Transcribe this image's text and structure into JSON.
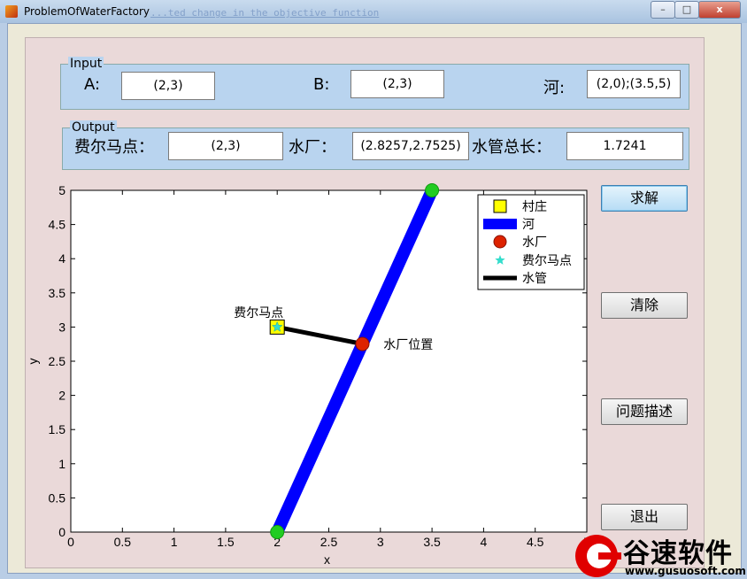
{
  "window": {
    "title": "ProblemOfWaterFactory",
    "ghost_text": "...ted change in the objective function",
    "min_label": "–",
    "max_label": "□",
    "close_label": "x"
  },
  "input": {
    "title": "Input",
    "a_label": "A:",
    "a_value": "(2,3)",
    "b_label": "B:",
    "b_value": "(2,3)",
    "river_label": "河:",
    "river_value": "(2,0);(3.5,5)"
  },
  "output": {
    "title": "Output",
    "fermat_label": "费尔马点：",
    "fermat_value": "(2,3)",
    "plant_label": "水厂：",
    "plant_value": "(2.8257,2.7525)",
    "pipe_label": "水管总长：",
    "pipe_value": "1.7241"
  },
  "buttons": {
    "solve": "求解",
    "clear": "清除",
    "describe": "问题描述",
    "exit": "退出"
  },
  "chart_data": {
    "type": "scatter",
    "xlabel": "x",
    "ylabel": "y",
    "xlim": [
      0,
      5
    ],
    "ylim": [
      0,
      5
    ],
    "xticks": [
      "0",
      "0.5",
      "1",
      "1.5",
      "2",
      "2.5",
      "3",
      "3.5",
      "4",
      "4.5",
      "5"
    ],
    "yticks": [
      "0",
      "0.5",
      "1",
      "1.5",
      "2",
      "2.5",
      "3",
      "3.5",
      "4",
      "4.5",
      "5"
    ],
    "river": {
      "name": "河",
      "x": [
        2,
        3.5
      ],
      "y": [
        0,
        5
      ],
      "color": "#0000ff"
    },
    "river_endpoints": {
      "x": [
        2,
        3.5
      ],
      "y": [
        0,
        5
      ],
      "color": "#22cc22"
    },
    "village": {
      "name": "村庄",
      "x": 2,
      "y": 3,
      "color": "#ffff00"
    },
    "plant": {
      "name": "水厂",
      "x": 2.8257,
      "y": 2.7525,
      "color": "#dd2200"
    },
    "fermat": {
      "name": "费尔马点",
      "x": 2,
      "y": 3,
      "color": "#33ddcc"
    },
    "pipe": {
      "name": "水管",
      "x": [
        2,
        2.8257
      ],
      "y": [
        3,
        2.7525
      ],
      "color": "#000000"
    },
    "annotations": [
      {
        "text": "费尔马点",
        "x": 1.58,
        "y": 3.15
      },
      {
        "text": "水厂位置",
        "x": 3.03,
        "y": 2.68
      }
    ],
    "legend_position": "top-right",
    "legend_labels": [
      "村庄",
      "河",
      "水厂",
      "费尔马点",
      "水管"
    ]
  },
  "watermark": {
    "name": "谷速软件",
    "url": "www.gusuosoft.com"
  }
}
